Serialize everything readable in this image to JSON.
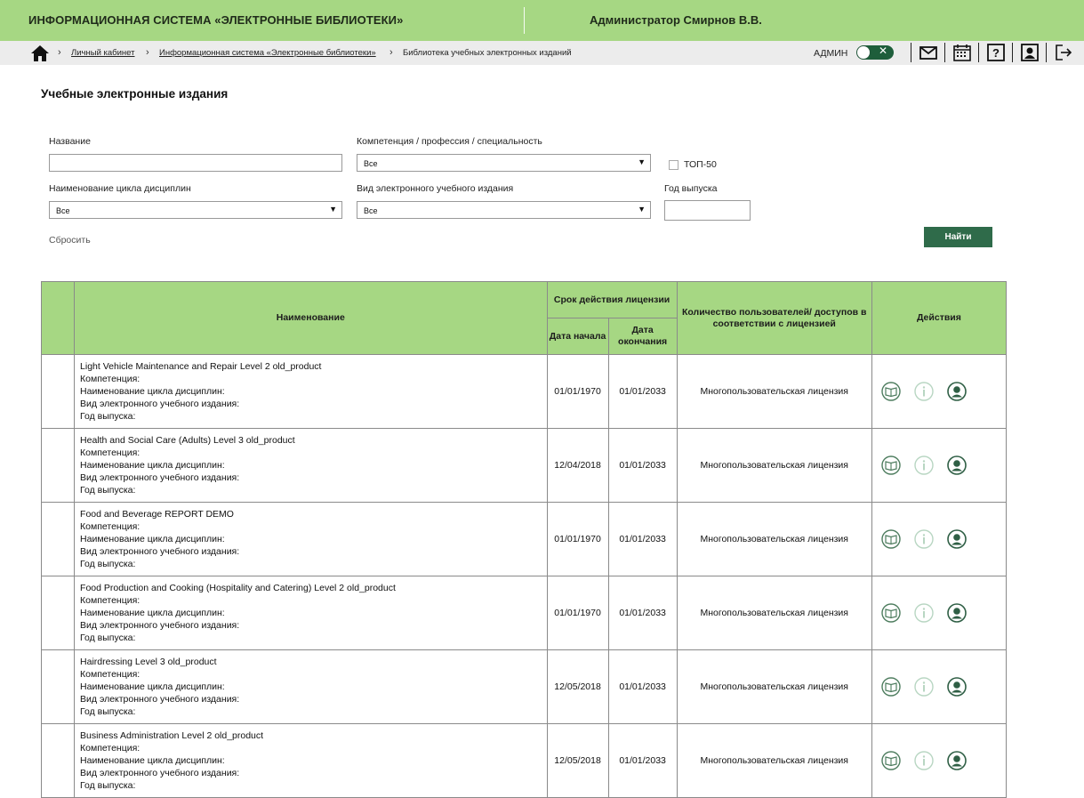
{
  "header": {
    "app_title": "ИНФОРМАЦИОННАЯ СИСТЕМА «ЭЛЕКТРОННЫЕ БИБЛИОТЕКИ»",
    "user_name": "Администратор Смирнов В.В."
  },
  "breadcrumb": {
    "items": [
      {
        "label": "Личный кабинет"
      },
      {
        "label": "Информационная система «Электронные библиотеки»"
      },
      {
        "label": "Библиотека учебных электронных изданий"
      }
    ]
  },
  "toolbar": {
    "admin_label": "АДМИН",
    "admin_toggle_mark": "✕",
    "icons": [
      "mail-icon",
      "calendar-icon",
      "help-icon",
      "profile-icon",
      "logout-icon"
    ]
  },
  "page": {
    "title": "Учебные электронные издания"
  },
  "filters": {
    "name_label": "Название",
    "name_value": "",
    "competence_label": "Компетенция / профессия / специальность",
    "competence_value": "Все",
    "top50_label": "ТОП-50",
    "top50_checked": false,
    "cycle_label": "Наименование цикла дисциплин",
    "cycle_value": "Все",
    "edition_type_label": "Вид электронного учебного издания",
    "edition_type_value": "Все",
    "year_label": "Год выпуска",
    "year_value": "",
    "reset_label": "Сбросить",
    "find_label": "Найти"
  },
  "table": {
    "headers": {
      "name": "Наименование",
      "license_term": "Срок действия лицензии",
      "start_date": "Дата начала",
      "end_date": "Дата окончания",
      "users_count": "Количество пользователей/ доступов в соответствии с лицензией",
      "actions": "Действия"
    },
    "field_labels": {
      "competence": "Компетенция:",
      "cycle": "Наименование цикла дисциплин:",
      "edition_type": "Вид электронного учебного издания:",
      "year": "Год выпуска:"
    },
    "rows": [
      {
        "name": "Light Vehicle Maintenance and Repair Level 2 old_product",
        "start": "01/01/1970",
        "end": "01/01/2033",
        "license": "Многопользовательская лицензия"
      },
      {
        "name": "Health and Social Care (Adults) Level 3 old_product",
        "start": "12/04/2018",
        "end": "01/01/2033",
        "license": "Многопользовательская лицензия"
      },
      {
        "name": "Food and Beverage REPORT DEMO",
        "start": "01/01/1970",
        "end": "01/01/2033",
        "license": "Многопользовательская лицензия"
      },
      {
        "name": "Food Production and Cooking (Hospitality and Catering) Level 2 old_product",
        "start": "01/01/1970",
        "end": "01/01/2033",
        "license": "Многопользовательская лицензия"
      },
      {
        "name": "Hairdressing Level 3 old_product",
        "start": "12/05/2018",
        "end": "01/01/2033",
        "license": "Многопользовательская лицензия"
      },
      {
        "name": "Business Administration Level 2 old_product",
        "start": "12/05/2018",
        "end": "01/01/2033",
        "license": "Многопользовательская лицензия"
      }
    ],
    "action_icons": [
      "book-icon",
      "info-icon",
      "user-icon"
    ]
  },
  "colors": {
    "header_green": "#a6d783",
    "dark_green": "#2f6b4a",
    "crumb_bg": "#ececec"
  }
}
